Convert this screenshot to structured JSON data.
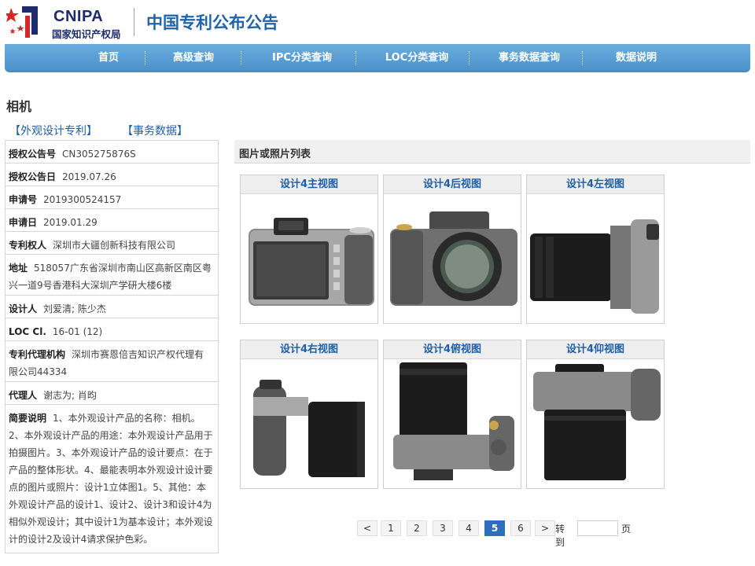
{
  "header": {
    "logo_top": "CNIPA",
    "logo_bottom": "国家知识产权局",
    "site_title": "中国专利公布公告"
  },
  "nav": [
    "首页",
    "高级查询",
    "IPC分类查询",
    "LOC分类查询",
    "事务数据查询",
    "数据说明"
  ],
  "page": {
    "title": "相机",
    "links": [
      "【外观设计专利】",
      "【事务数据】"
    ]
  },
  "info": [
    {
      "label": "授权公告号",
      "value": "CN305275876S"
    },
    {
      "label": "授权公告日",
      "value": "2019.07.26"
    },
    {
      "label": "申请号",
      "value": "2019300524157"
    },
    {
      "label": "申请日",
      "value": "2019.01.29"
    },
    {
      "label": "专利权人",
      "value": "深圳市大疆创新科技有限公司"
    },
    {
      "label": "地址",
      "value": "518057广东省深圳市南山区高新区南区粤兴一道9号香港科大深圳产学研大楼6楼"
    },
    {
      "label": "设计人",
      "value": "刘爱清; 陈少杰"
    },
    {
      "label": "LOC Cl.",
      "value": "16-01 (12)"
    },
    {
      "label": "专利代理机构",
      "value": "深圳市赛恩倍吉知识产权代理有限公司44334"
    },
    {
      "label": "代理人",
      "value": "谢志为; 肖昀"
    },
    {
      "label": "简要说明",
      "value": "1、本外观设计产品的名称：相机。2、本外观设计产品的用途：本外观设计产品用于拍摄图片。3、本外观设计产品的设计要点：在于产品的整体形状。4、最能表明本外观设计设计要点的图片或照片：设计1立体图1。5、其他：本外观设计产品的设计1、设计2、设计3和设计4为相似外观设计；其中设计1为基本设计；本外观设计的设计2及设计4请求保护色彩。"
    }
  ],
  "gallery": {
    "title": "图片或照片列表",
    "images": [
      "设计4主视图",
      "设计4后视图",
      "设计4左视图",
      "设计4右视图",
      "设计4俯视图",
      "设计4仰视图"
    ]
  },
  "pager": {
    "prev": "<",
    "pages": [
      "1",
      "2",
      "3",
      "4",
      "5",
      "6"
    ],
    "current": "5",
    "next": ">",
    "goto_label": "转到",
    "goto_suffix": "页",
    "goto_value": ""
  }
}
